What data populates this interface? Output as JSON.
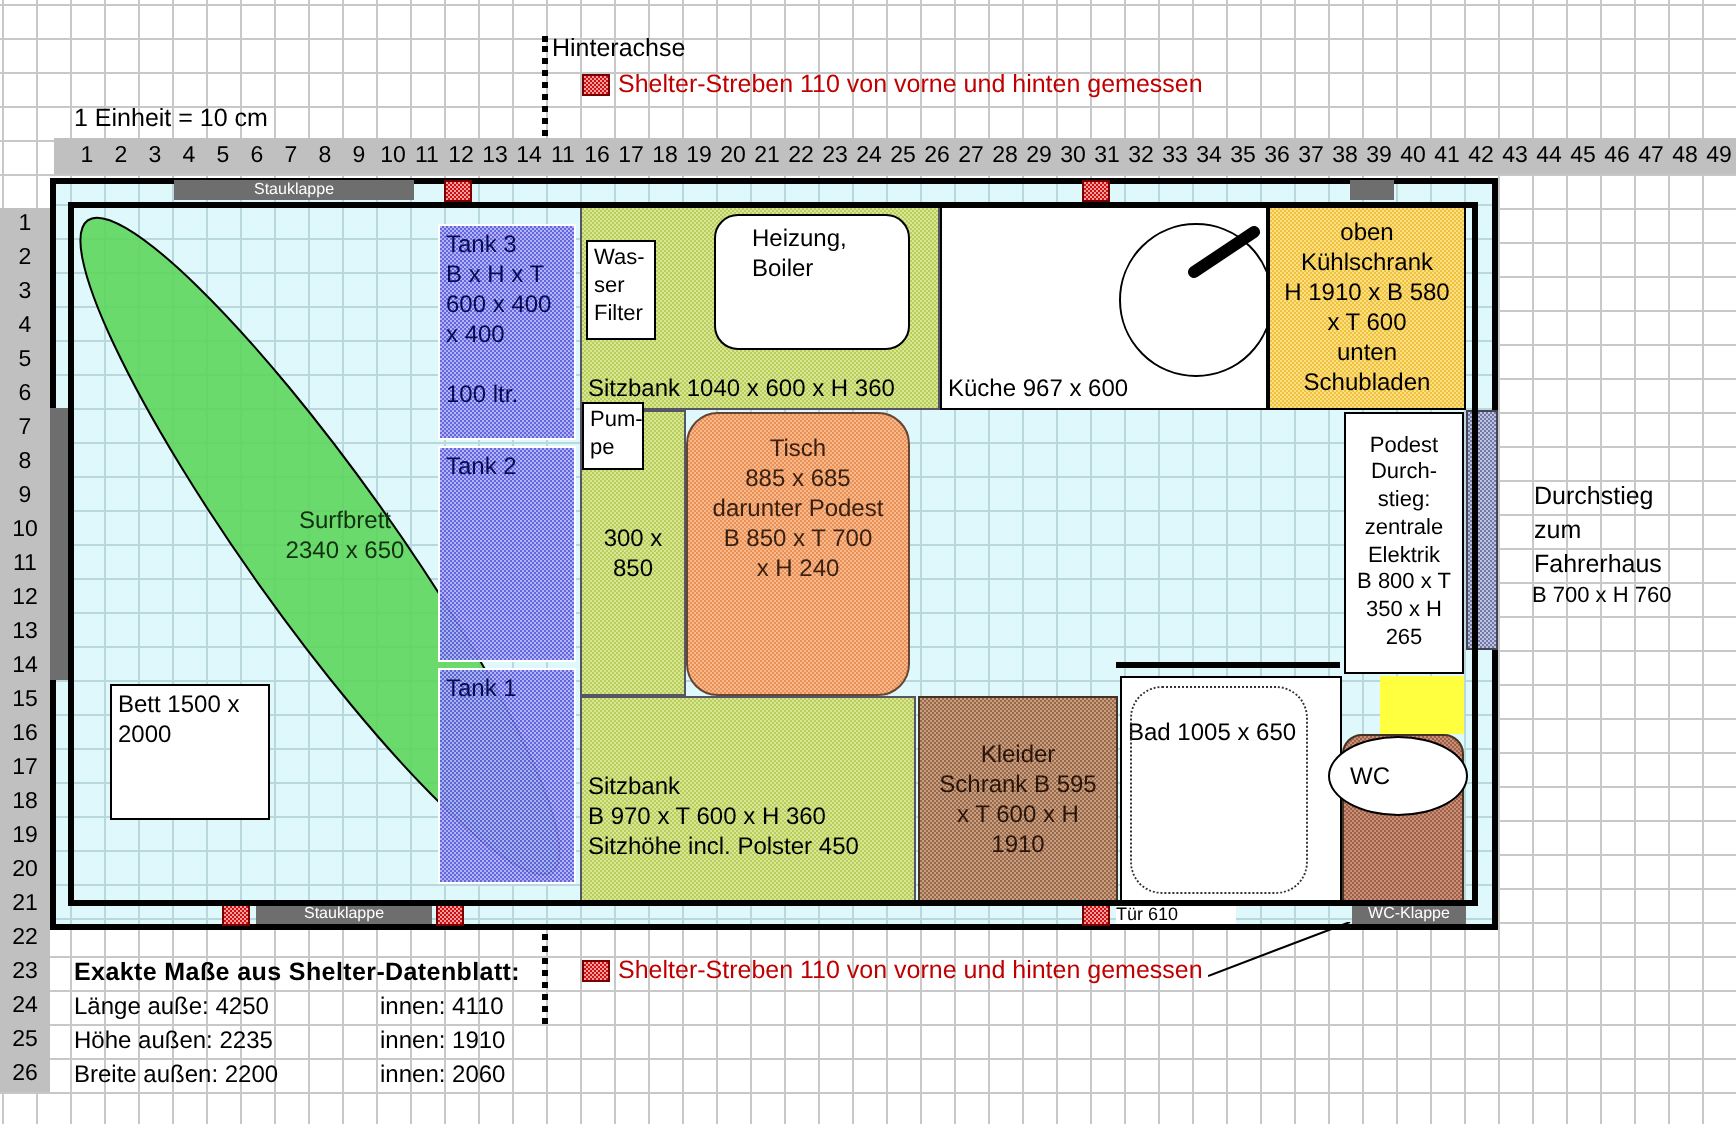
{
  "axle_label": "Hinterachse",
  "legend_top": {
    "text": "Shelter-Streben 110 von vorne und hinten gemessen"
  },
  "scale_note": "1 Einheit = 10 cm",
  "column_numbers": [
    "1",
    "2",
    "3",
    "4",
    "5",
    "6",
    "7",
    "8",
    "9",
    "10",
    "11",
    "12",
    "13",
    "14",
    "11",
    "16",
    "17",
    "18",
    "19",
    "20",
    "21",
    "22",
    "23",
    "24",
    "25",
    "26",
    "27",
    "28",
    "29",
    "30",
    "31",
    "32",
    "33",
    "34",
    "35",
    "36",
    "37",
    "38",
    "39",
    "40",
    "41",
    "42",
    "43",
    "44",
    "45",
    "46",
    "47",
    "48",
    "49"
  ],
  "row_numbers": [
    "1",
    "2",
    "3",
    "4",
    "5",
    "6",
    "7",
    "8",
    "9",
    "10",
    "11",
    "12",
    "13",
    "14",
    "15",
    "16",
    "17",
    "18",
    "19",
    "20",
    "21",
    "22",
    "23",
    "24",
    "25",
    "26"
  ],
  "flaps": [
    {
      "label": "Stauklappe"
    },
    {
      "label": "Stauklappe"
    },
    {
      "label": "Tür 610"
    },
    {
      "label": "WC-Klappe"
    }
  ],
  "rooms": [
    {
      "kind": "board",
      "text": "Surfbrett\n2340 x 650"
    },
    {
      "kind": "bed",
      "text": "Bett 1500 x\n2000"
    },
    {
      "kind": "tank",
      "text": "Tank 3\nB x H x T\n600 x 400\nx 400\n\n100 ltr."
    },
    {
      "kind": "tank",
      "text": "Tank 2"
    },
    {
      "kind": "tank",
      "text": "Tank 1"
    },
    {
      "kind": "box",
      "text": "Was-\nser\nFilter"
    },
    {
      "kind": "heater",
      "text": "Heizung,\nBoiler"
    },
    {
      "kind": "bench",
      "text": "Sitzbank 1040 x 600 x H 360"
    },
    {
      "kind": "box",
      "text": "Pum-\npe"
    },
    {
      "kind": "bench",
      "text": "300 x\n850"
    },
    {
      "kind": "table",
      "text": "Tisch\n885 x 685\ndarunter Podest\nB 850 x T 700\nx H 240"
    },
    {
      "kind": "bench",
      "text": "Sitzbank\nB 970 x T 600 x H 360\nSitzhöhe incl. Polster 450"
    },
    {
      "kind": "kitchen",
      "text": "Küche 967 x 600"
    },
    {
      "kind": "fridge",
      "text": "oben\nKühlschrank\nH 1910 x B 580\nx T 600\nunten\nSchubladen"
    },
    {
      "kind": "platform",
      "text": "Podest\nDurch-\nstieg:\nzentrale\nElektrik\nB 800 x T\n350 x H\n265"
    },
    {
      "kind": "wardrobe",
      "text": "Kleider\nSchrank B 595\nx T 600 x H\n1910"
    },
    {
      "kind": "bath",
      "text": "Bad 1005 x 650"
    },
    {
      "kind": "wc",
      "text": "WC"
    }
  ],
  "passage": {
    "text": "Durchstieg\nzum\nFahrerhaus",
    "size": "B 700 x  H 760"
  },
  "legend_bottom": {
    "text": "Shelter-Streben 110 von vorne und hinten gemessen"
  },
  "datasheet": {
    "title": "Exakte Maße aus Shelter-Datenblatt:",
    "rows": [
      {
        "outer": "Länge auße: 4250",
        "inner": "innen: 4110"
      },
      {
        "outer": "Höhe außen: 2235",
        "inner": "innen: 1910"
      },
      {
        "outer": "Breite außen: 2200",
        "inner": "innen: 2060"
      }
    ]
  }
}
